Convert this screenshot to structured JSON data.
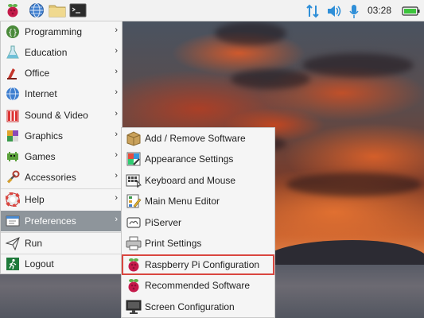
{
  "taskbar": {
    "launchers": [
      {
        "name": "raspberry-menu-icon"
      },
      {
        "name": "web-browser-icon"
      },
      {
        "name": "file-manager-icon"
      },
      {
        "name": "terminal-icon"
      }
    ],
    "tray": {
      "network": "network-arrows-icon",
      "volume": "volume-icon",
      "microphone": "microphone-icon",
      "battery": "battery-icon",
      "clock": "03:28"
    }
  },
  "main_menu": {
    "items": [
      {
        "label": "Programming",
        "icon": "programming-icon",
        "submenu": true
      },
      {
        "label": "Education",
        "icon": "education-icon",
        "submenu": true
      },
      {
        "label": "Office",
        "icon": "office-icon",
        "submenu": true
      },
      {
        "label": "Internet",
        "icon": "internet-icon",
        "submenu": true
      },
      {
        "label": "Sound & Video",
        "icon": "sound-video-icon",
        "submenu": true
      },
      {
        "label": "Graphics",
        "icon": "graphics-icon",
        "submenu": true
      },
      {
        "label": "Games",
        "icon": "games-icon",
        "submenu": true
      },
      {
        "label": "Accessories",
        "icon": "accessories-icon",
        "submenu": true
      },
      {
        "label": "Help",
        "icon": "help-icon",
        "submenu": true
      },
      {
        "label": "Preferences",
        "icon": "preferences-icon",
        "submenu": true
      },
      {
        "label": "Run",
        "icon": "run-icon",
        "submenu": false
      },
      {
        "label": "Logout",
        "icon": "logout-icon",
        "submenu": false
      }
    ],
    "arrow": "›",
    "active_index": 9
  },
  "preferences_submenu": {
    "items": [
      {
        "label": "Add / Remove Software",
        "icon": "add-remove-software-icon"
      },
      {
        "label": "Appearance Settings",
        "icon": "appearance-settings-icon"
      },
      {
        "label": "Keyboard and Mouse",
        "icon": "keyboard-mouse-icon"
      },
      {
        "label": "Main Menu Editor",
        "icon": "main-menu-editor-icon"
      },
      {
        "label": "PiServer",
        "icon": "piserver-icon"
      },
      {
        "label": "Print Settings",
        "icon": "printer-icon"
      },
      {
        "label": "Raspberry Pi Configuration",
        "icon": "raspberry-pi-icon"
      },
      {
        "label": "Recommended Software",
        "icon": "raspberry-pi-icon"
      },
      {
        "label": "Screen Configuration",
        "icon": "monitor-icon"
      }
    ],
    "highlighted_index": 6,
    "highlight_color": "#d9463f"
  },
  "colors": {
    "menu_active": "#8e959b",
    "tray_accent": "#2f8fd8"
  }
}
